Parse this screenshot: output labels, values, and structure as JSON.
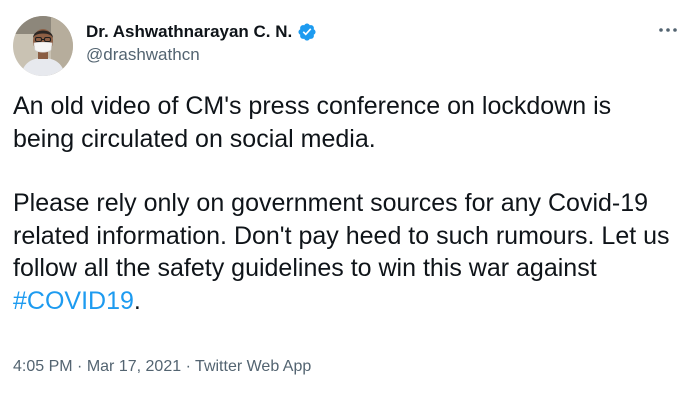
{
  "author": {
    "display_name": "Dr. Ashwathnarayan C. N.",
    "handle": "@drashwathcn",
    "verified": true,
    "verified_color": "#1d9bf0"
  },
  "tweet": {
    "paragraph_1": "An old video of CM's press conference on lockdown is being circulated on social media.",
    "paragraph_2_text": "Please rely only on government sources for any Covid-19 related information. Don't pay heed to such rumours. Let us follow all the safety guidelines to win this war against ",
    "hashtag": "#COVID19",
    "paragraph_2_end": ".",
    "hashtag_color": "#1d9bf0"
  },
  "meta": {
    "time": "4:05 PM",
    "separator": "·",
    "date": "Mar 17, 2021",
    "source": "Twitter Web App"
  },
  "icons": {
    "more": "more-options-icon",
    "verified": "verified-badge-icon"
  }
}
